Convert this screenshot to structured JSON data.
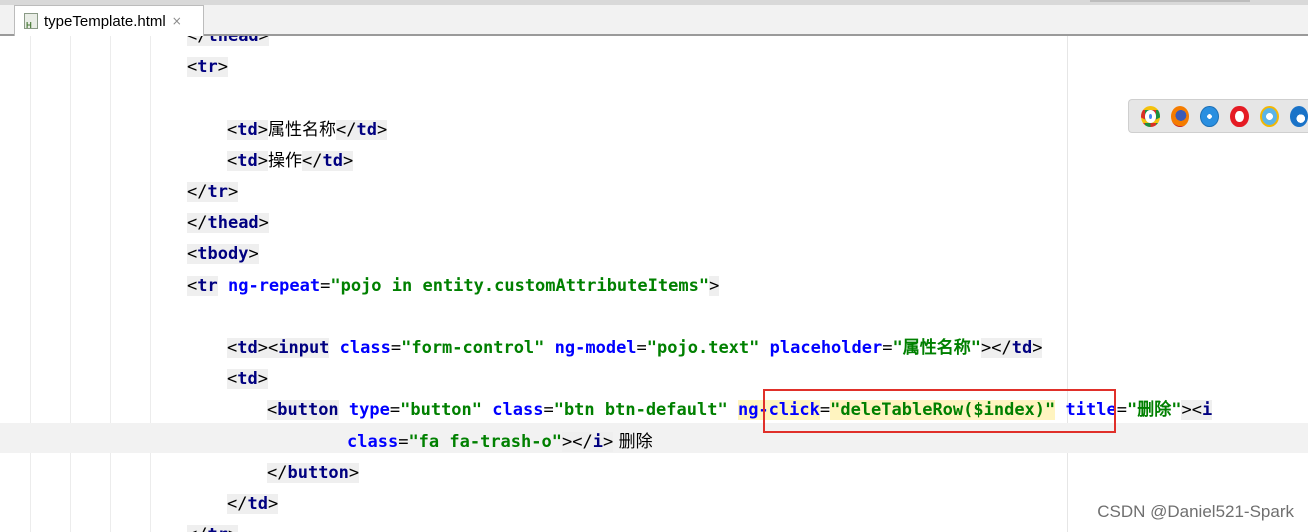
{
  "tab": {
    "title": "typeTemplate.html",
    "close": "×"
  },
  "code_lines": [
    {
      "indent": 0,
      "text": "</thead>",
      "partial": true
    },
    {
      "indent": 0,
      "text": "<tr>"
    },
    {
      "indent": 0,
      "text": ""
    },
    {
      "indent": 1,
      "text": "<td>属性名称</td>"
    },
    {
      "indent": 1,
      "text": "<td>操作</td>"
    },
    {
      "indent": 0,
      "text": "</tr>"
    },
    {
      "indent": 0,
      "text": "</thead>"
    },
    {
      "indent": 0,
      "text": "<tbody>"
    },
    {
      "indent": 0,
      "text": "<tr ng-repeat=\"pojo in entity.customAttributeItems\">"
    },
    {
      "indent": 0,
      "text": ""
    },
    {
      "indent": 1,
      "text": "<td><input class=\"form-control\" ng-model=\"pojo.text\" placeholder=\"属性名称\"></td>"
    },
    {
      "indent": 1,
      "text": "<td>"
    },
    {
      "indent": 2,
      "text": "<button type=\"button\" class=\"btn btn-default\" ng-click=\"deleTableRow($index)\" title=\"删除\"><i"
    },
    {
      "indent": 4,
      "text": "class=\"fa fa-trash-o\"></i> 删除"
    },
    {
      "indent": 2,
      "text": "</button>"
    },
    {
      "indent": 1,
      "text": "</td>"
    },
    {
      "indent": 0,
      "text": "</tr>",
      "partial": true
    }
  ],
  "browser_icons": [
    "chrome-icon",
    "firefox-icon",
    "safari-icon",
    "opera-icon",
    "ie-icon",
    "edge-icon"
  ],
  "watermark": "CSDN @Daniel521-Spark"
}
